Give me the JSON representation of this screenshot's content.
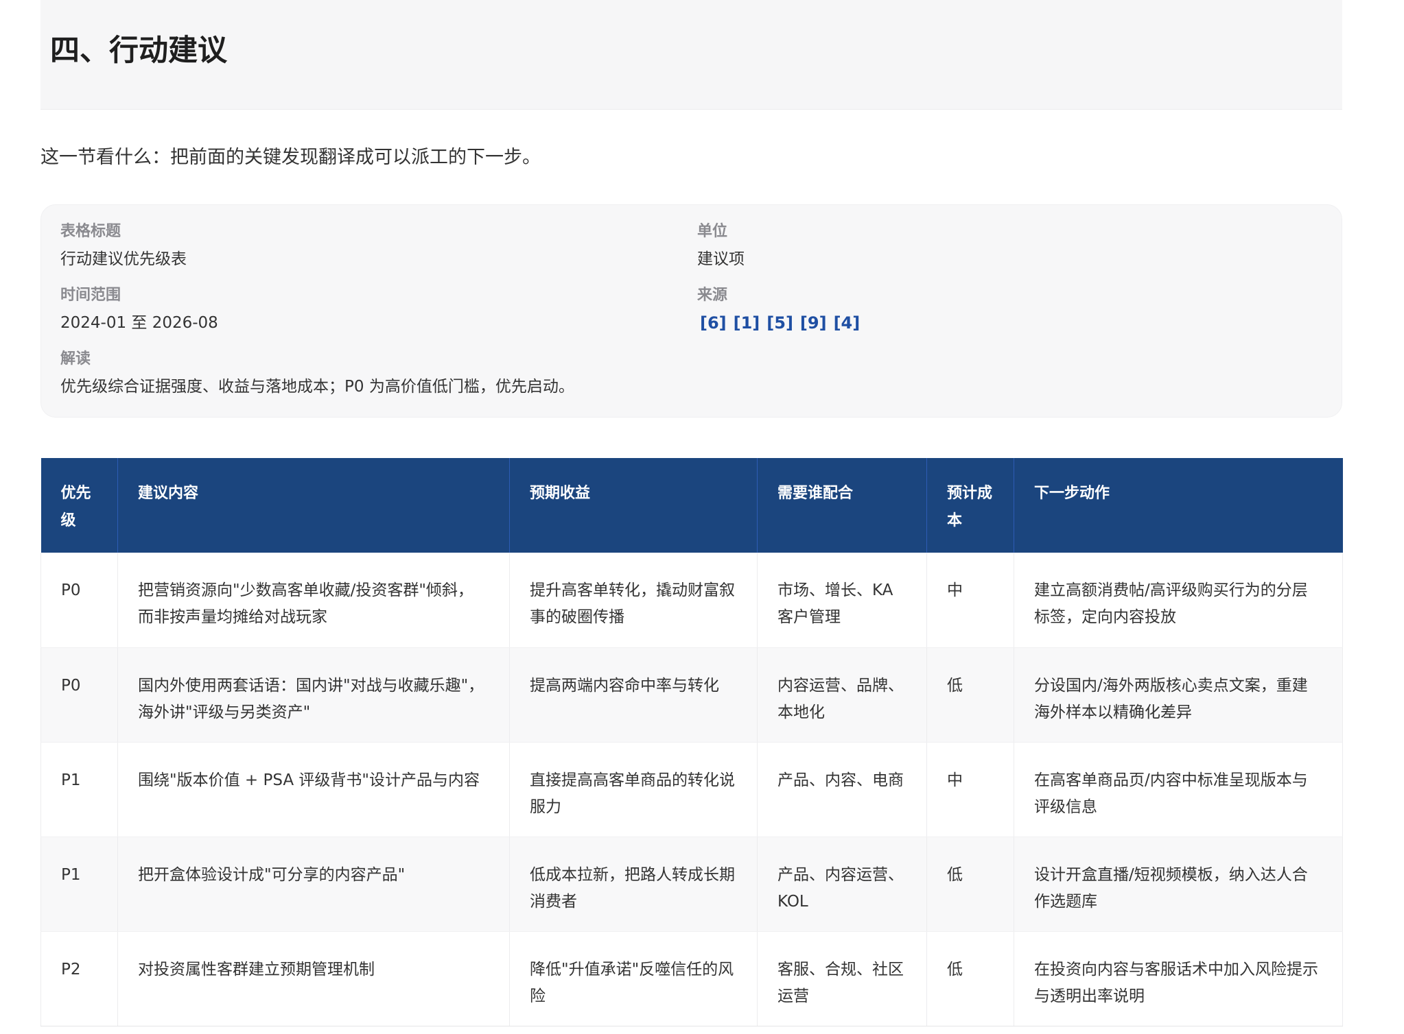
{
  "section": {
    "title": "四、行动建议",
    "intro": "这一节看什么：把前面的关键发现翻译成可以派工的下一步。"
  },
  "meta": {
    "table_title_label": "表格标题",
    "table_title_value": "行动建议优先级表",
    "unit_label": "单位",
    "unit_value": "建议项",
    "time_range_label": "时间范围",
    "time_range_value": "2024-01 至 2026-08",
    "source_label": "来源",
    "sources": [
      "[6]",
      "[1]",
      "[5]",
      "[9]",
      "[4]"
    ],
    "interpretation_label": "解读",
    "interpretation_value": "优先级综合证据强度、收益与落地成本；P0 为高价值低门槛，优先启动。"
  },
  "table": {
    "headers": [
      "优先级",
      "建议内容",
      "预期收益",
      "需要谁配合",
      "预计成本",
      "下一步动作"
    ],
    "rows": [
      [
        "P0",
        "把营销资源向\"少数高客单收藏/投资客群\"倾斜，而非按声量均摊给对战玩家",
        "提升高客单转化，撬动财富叙事的破圈传播",
        "市场、增长、KA 客户管理",
        "中",
        "建立高额消费帖/高评级购买行为的分层标签，定向内容投放"
      ],
      [
        "P0",
        "国内外使用两套话语：国内讲\"对战与收藏乐趣\"，海外讲\"评级与另类资产\"",
        "提高两端内容命中率与转化",
        "内容运营、品牌、本地化",
        "低",
        "分设国内/海外两版核心卖点文案，重建海外样本以精确化差异"
      ],
      [
        "P1",
        "围绕\"版本价值 + PSA 评级背书\"设计产品与内容",
        "直接提高高客单商品的转化说服力",
        "产品、内容、电商",
        "中",
        "在高客单商品页/内容中标准呈现版本与评级信息"
      ],
      [
        "P1",
        "把开盒体验设计成\"可分享的内容产品\"",
        "低成本拉新，把路人转成长期消费者",
        "产品、内容运营、KOL",
        "低",
        "设计开盒直播/短视频模板，纳入达人合作选题库"
      ],
      [
        "P2",
        "对投资属性客群建立预期管理机制",
        "降低\"升值承诺\"反噬信任的风险",
        "客服、合规、社区运营",
        "低",
        "在投资向内容与客服话术中加入风险提示与透明出率说明"
      ]
    ]
  }
}
